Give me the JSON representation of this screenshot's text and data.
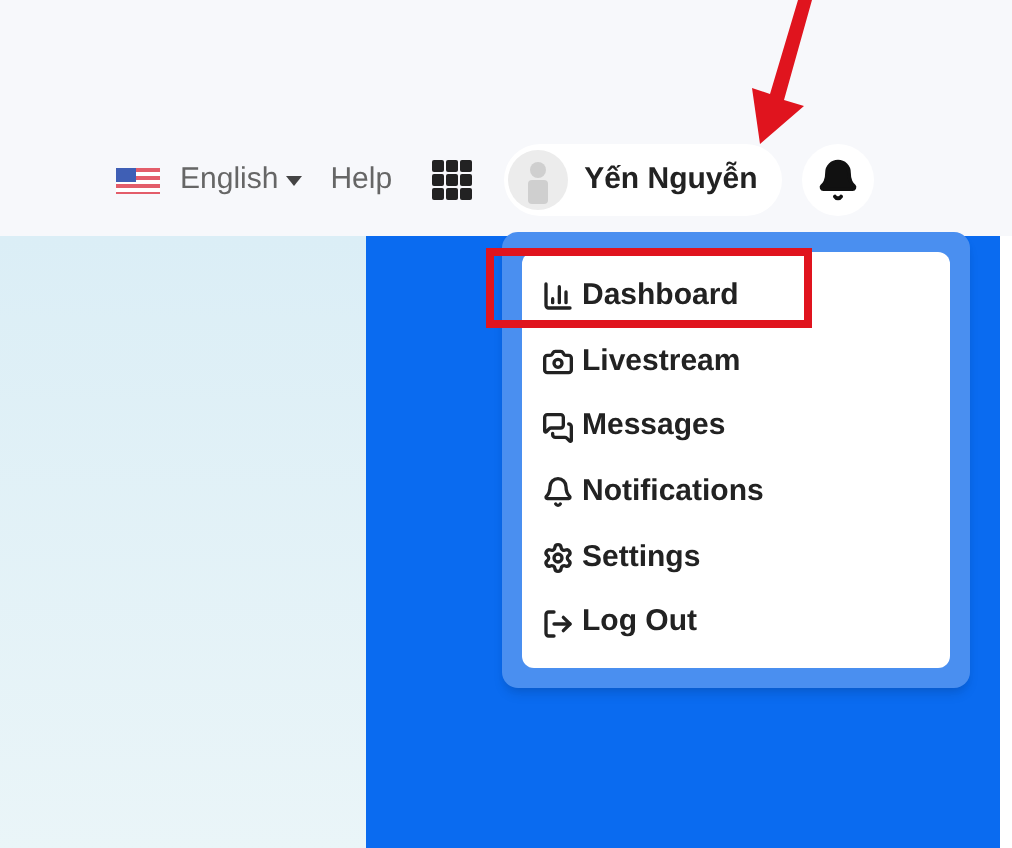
{
  "header": {
    "language": "English",
    "help": "Help",
    "user_name": "Yến Nguyễn"
  },
  "user_menu": {
    "expanded": true,
    "items": [
      {
        "label": "Dashboard",
        "highlighted": true
      },
      {
        "label": "Livestream",
        "highlighted": false
      },
      {
        "label": "Messages",
        "highlighted": false
      },
      {
        "label": "Notifications",
        "highlighted": false
      },
      {
        "label": "Settings",
        "highlighted": false
      },
      {
        "label": "Log Out",
        "highlighted": false
      }
    ]
  }
}
